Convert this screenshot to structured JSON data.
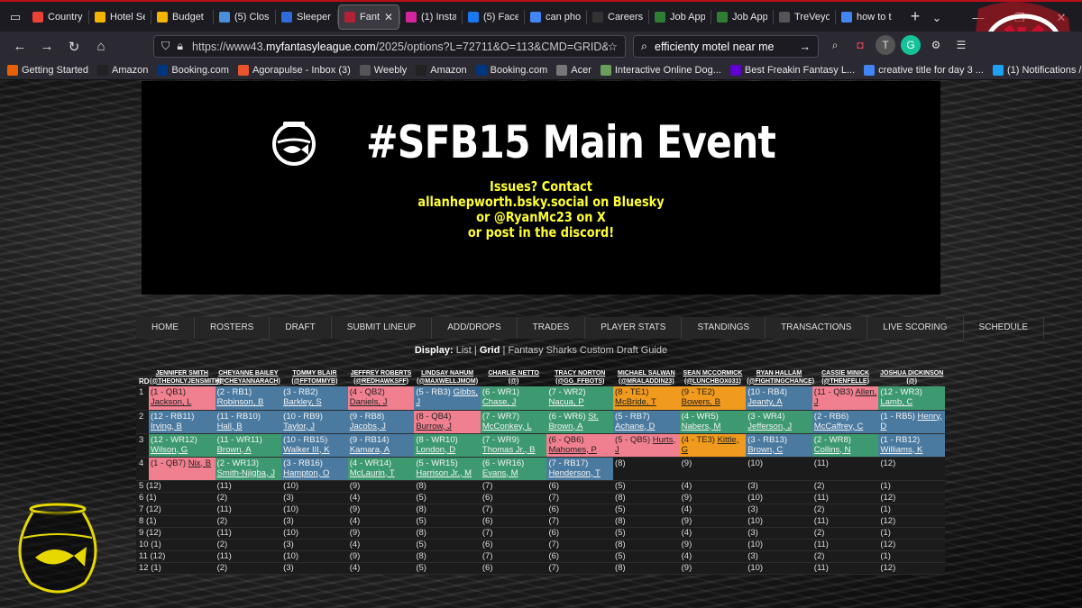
{
  "browser": {
    "tabs": [
      {
        "title": "Country",
        "icon": "gmail-icon",
        "color": "#ea4335"
      },
      {
        "title": "Hotel Se",
        "icon": "sheets-icon",
        "color": "#f4b400"
      },
      {
        "title": "Budget",
        "icon": "sheets-icon",
        "color": "#f4b400"
      },
      {
        "title": "(5) Close",
        "icon": "chat-icon",
        "color": "#4a90d9"
      },
      {
        "title": "Sleeper",
        "icon": "sleeper-icon",
        "color": "#2f6bd9"
      },
      {
        "title": "Fant",
        "icon": "mfl-icon",
        "color": "#b22234",
        "active": true
      },
      {
        "title": "(1) Insta",
        "icon": "instagram-icon",
        "color": "#d6249f"
      },
      {
        "title": "(5) Faceb",
        "icon": "facebook-icon",
        "color": "#1877f2"
      },
      {
        "title": "can phon",
        "icon": "google-icon",
        "color": "#4285f4"
      },
      {
        "title": "Careers",
        "icon": "careers-icon",
        "color": "#333333"
      },
      {
        "title": "Job App",
        "icon": "job-icon",
        "color": "#2e7d32"
      },
      {
        "title": "Job App",
        "icon": "job-icon",
        "color": "#2e7d32"
      },
      {
        "title": "TreVeyor",
        "icon": "fp-icon",
        "color": "#555555"
      },
      {
        "title": "how to t",
        "icon": "google-icon",
        "color": "#4285f4"
      }
    ],
    "close_glyph": "✕",
    "url_prefix": "https://www43.",
    "url_domain": "myfantasyleague.com",
    "url_rest": "/2025/options?L=72711&O=113&CMD=GRID&DISPLAY=",
    "search_text": "efficienty motel near me",
    "bookmarks": [
      {
        "label": "Getting Started",
        "icon": "firefox-icon",
        "color": "#e66000"
      },
      {
        "label": "Amazon",
        "icon": "amazon-icon",
        "color": "#222222"
      },
      {
        "label": "Booking.com",
        "icon": "booking-icon",
        "color": "#003580"
      },
      {
        "label": "Agorapulse - Inbox (3)",
        "icon": "agorapulse-icon",
        "color": "#e8542b"
      },
      {
        "label": "Weebly",
        "icon": "weebly-icon",
        "color": "#555555"
      },
      {
        "label": "Amazon",
        "icon": "amazon-icon",
        "color": "#222222"
      },
      {
        "label": "Booking.com",
        "icon": "booking-icon",
        "color": "#003580"
      },
      {
        "label": "Acer",
        "icon": "folder-icon",
        "color": "#777777"
      },
      {
        "label": "Interactive Online Dog...",
        "icon": "dog-icon",
        "color": "#6a9e5a"
      },
      {
        "label": "Best Freakin Fantasy L...",
        "icon": "yahoo-icon",
        "color": "#6001d2"
      },
      {
        "label": "creative title for day 3 ...",
        "icon": "google-icon",
        "color": "#4285f4"
      },
      {
        "label": "(1) Notifications / Twit...",
        "icon": "twitter-icon",
        "color": "#1da1f2"
      }
    ]
  },
  "banner": {
    "title": "#SFB15 Main Event",
    "contact_lines": [
      "Issues? Contact",
      "allanhepworth.bsky.social on Bluesky",
      "or @RyanMc23 on X",
      "or post in the discord!"
    ]
  },
  "menu": [
    "HOME",
    "ROSTERS",
    "DRAFT",
    "SUBMIT LINEUP",
    "ADD/DROPS",
    "TRADES",
    "PLAYER STATS",
    "STANDINGS",
    "TRANSACTIONS",
    "LIVE SCORING",
    "SCHEDULE"
  ],
  "display": {
    "label": "Display:",
    "list": "List",
    "sep": "|",
    "grid": "Grid",
    "guide": "Fantasy Sharks Custom Draft Guide"
  },
  "draft": {
    "rd_header": "RD",
    "teams": [
      {
        "name": "JENNIFER SMITH",
        "handle": "(@THEONLYJENSMITH)"
      },
      {
        "name": "CHEYANNE BAILEY",
        "handle": "(@CHEYANNARACH)"
      },
      {
        "name": "TOMMY BLAIR",
        "handle": "(@FFTOMMYB)"
      },
      {
        "name": "JEFFREY ROBERTS",
        "handle": "(@REDHAWKSFF)"
      },
      {
        "name": "LINDSAY NAHUM",
        "handle": "(@MAXWELLJMOM)"
      },
      {
        "name": "CHARLIE NETTO",
        "handle": "(@)"
      },
      {
        "name": "TRACY NORTON",
        "handle": "(@GG_FFBOTS)"
      },
      {
        "name": "MICHAEL SALWAN",
        "handle": "(@MRALADDIN23)"
      },
      {
        "name": "SEAN MCCORMICK",
        "handle": "(@LUNCHBOX031)"
      },
      {
        "name": "RYAN HALLAM",
        "handle": "(@FIGHTINGCHANCE)"
      },
      {
        "name": "CASSIE MINICK",
        "handle": "(@THENFELLE)"
      },
      {
        "name": "JOSHUA DICKINSON",
        "handle": "(@)"
      }
    ],
    "picks": [
      {
        "rd": "1",
        "cells": [
          {
            "pos": "QB",
            "tag": "(1 - QB1)",
            "player": "Jackson, L"
          },
          {
            "pos": "RB",
            "tag": "(2 - RB1)",
            "player": "Robinson, B"
          },
          {
            "pos": "RB",
            "tag": "(3 - RB2)",
            "player": "Barkley, S"
          },
          {
            "pos": "QB",
            "tag": "(4 - QB2)",
            "player": "Daniels, J"
          },
          {
            "pos": "RB",
            "tag": "(5 - RB3)",
            "player": "Gibbs, J"
          },
          {
            "pos": "WR",
            "tag": "(6 - WR1)",
            "player": "Chase, J"
          },
          {
            "pos": "WR",
            "tag": "(7 - WR2)",
            "player": "Nacua, P"
          },
          {
            "pos": "TE",
            "tag": "(8 - TE1)",
            "player": "McBride, T"
          },
          {
            "pos": "TE",
            "tag": "(9 - TE2)",
            "player": "Bowers, B"
          },
          {
            "pos": "RB",
            "tag": "(10 - RB4)",
            "player": "Jeanty, A"
          },
          {
            "pos": "QB",
            "tag": "(11 - QB3)",
            "player": "Allen, J"
          },
          {
            "pos": "WR",
            "tag": "(12 - WR3)",
            "player": "Lamb, C"
          }
        ]
      },
      {
        "rd": "2",
        "cells": [
          {
            "pos": "RB",
            "tag": "(12 - RB11)",
            "player": "Irving, B"
          },
          {
            "pos": "RB",
            "tag": "(11 - RB10)",
            "player": "Hall, B"
          },
          {
            "pos": "RB",
            "tag": "(10 - RB9)",
            "player": "Taylor, J"
          },
          {
            "pos": "RB",
            "tag": "(9 - RB8)",
            "player": "Jacobs, J"
          },
          {
            "pos": "QB",
            "tag": "(8 - QB4)",
            "player": "Burrow, J"
          },
          {
            "pos": "WR",
            "tag": "(7 - WR7)",
            "player": "McConkey, L"
          },
          {
            "pos": "WR",
            "tag": "(6 - WR6)",
            "player": "St. Brown, A"
          },
          {
            "pos": "RB",
            "tag": "(5 - RB7)",
            "player": "Achane, D"
          },
          {
            "pos": "WR",
            "tag": "(4 - WR5)",
            "player": "Nabers, M"
          },
          {
            "pos": "WR",
            "tag": "(3 - WR4)",
            "player": "Jefferson, J"
          },
          {
            "pos": "RB",
            "tag": "(2 - RB6)",
            "player": "McCaffrey, C"
          },
          {
            "pos": "RB",
            "tag": "(1 - RB5)",
            "player": "Henry, D"
          }
        ]
      },
      {
        "rd": "3",
        "cells": [
          {
            "pos": "WR",
            "tag": "(12 - WR12)",
            "player": "Wilson, G"
          },
          {
            "pos": "WR",
            "tag": "(11 - WR11)",
            "player": "Brown, A"
          },
          {
            "pos": "RB",
            "tag": "(10 - RB15)",
            "player": "Walker III, K"
          },
          {
            "pos": "RB",
            "tag": "(9 - RB14)",
            "player": "Kamara, A"
          },
          {
            "pos": "WR",
            "tag": "(8 - WR10)",
            "player": "London, D"
          },
          {
            "pos": "WR",
            "tag": "(7 - WR9)",
            "player": "Thomas Jr., B"
          },
          {
            "pos": "QB",
            "tag": "(6 - QB6)",
            "player": "Mahomes, P"
          },
          {
            "pos": "QB",
            "tag": "(5 - QB5)",
            "player": "Hurts, J"
          },
          {
            "pos": "TE",
            "tag": "(4 - TE3)",
            "player": "Kittle, G"
          },
          {
            "pos": "RB",
            "tag": "(3 - RB13)",
            "player": "Brown, C"
          },
          {
            "pos": "WR",
            "tag": "(2 - WR8)",
            "player": "Collins, N"
          },
          {
            "pos": "RB",
            "tag": "(1 - RB12)",
            "player": "Williams, K"
          }
        ]
      },
      {
        "rd": "4",
        "cells": [
          {
            "pos": "QB",
            "tag": "(1 - QB7)",
            "player": "Nix, B"
          },
          {
            "pos": "WR",
            "tag": "(2 - WR13)",
            "player": "Smith-Njigba, J"
          },
          {
            "pos": "RB",
            "tag": "(3 - RB16)",
            "player": "Hampton, O"
          },
          {
            "pos": "WR",
            "tag": "(4 - WR14)",
            "player": "McLaurin, T"
          },
          {
            "pos": "WR",
            "tag": "(5 - WR15)",
            "player": "Harrison Jr., M"
          },
          {
            "pos": "WR",
            "tag": "(6 - WR16)",
            "player": "Evans, M"
          },
          {
            "pos": "RB",
            "tag": "(7 - RB17)",
            "player": "Henderson, T"
          },
          {
            "pos": "",
            "tag": "(8)",
            "player": ""
          },
          {
            "pos": "",
            "tag": "(9)",
            "player": ""
          },
          {
            "pos": "",
            "tag": "(10)",
            "player": ""
          },
          {
            "pos": "",
            "tag": "(11)",
            "player": ""
          },
          {
            "pos": "",
            "tag": "(12)",
            "player": ""
          }
        ]
      }
    ],
    "future_rows": [
      {
        "rd": "5",
        "first": "(12)",
        "slots": [
          "(11)",
          "(10)",
          "(9)",
          "(8)",
          "(7)",
          "(6)",
          "(5)",
          "(4)",
          "(3)",
          "(2)",
          "(1)"
        ]
      },
      {
        "rd": "6",
        "first": "(1)",
        "slots": [
          "(2)",
          "(3)",
          "(4)",
          "(5)",
          "(6)",
          "(7)",
          "(8)",
          "(9)",
          "(10)",
          "(11)",
          "(12)"
        ]
      },
      {
        "rd": "7",
        "first": "(12)",
        "slots": [
          "(11)",
          "(10)",
          "(9)",
          "(8)",
          "(7)",
          "(6)",
          "(5)",
          "(4)",
          "(3)",
          "(2)",
          "(1)"
        ]
      },
      {
        "rd": "8",
        "first": "(1)",
        "slots": [
          "(2)",
          "(3)",
          "(4)",
          "(5)",
          "(6)",
          "(7)",
          "(8)",
          "(9)",
          "(10)",
          "(11)",
          "(12)"
        ]
      },
      {
        "rd": "9",
        "first": "(12)",
        "slots": [
          "(11)",
          "(10)",
          "(9)",
          "(8)",
          "(7)",
          "(6)",
          "(5)",
          "(4)",
          "(3)",
          "(2)",
          "(1)"
        ]
      },
      {
        "rd": "10",
        "first": "(1)",
        "slots": [
          "(2)",
          "(3)",
          "(4)",
          "(5)",
          "(6)",
          "(7)",
          "(8)",
          "(9)",
          "(10)",
          "(11)",
          "(12)"
        ]
      },
      {
        "rd": "11",
        "first": "(12)",
        "slots": [
          "(11)",
          "(10)",
          "(9)",
          "(8)",
          "(7)",
          "(6)",
          "(5)",
          "(4)",
          "(3)",
          "(2)",
          "(1)"
        ]
      },
      {
        "rd": "12",
        "first": "(1)",
        "slots": [
          "(2)",
          "(3)",
          "(4)",
          "(5)",
          "(6)",
          "(7)",
          "(8)",
          "(9)",
          "(10)",
          "(11)",
          "(12)"
        ]
      }
    ]
  },
  "colors": {
    "QB": "#f08090",
    "RB": "#4a7aa0",
    "WR": "#3d9a70",
    "TE": "#f09a1e",
    "banner_text": "#ffff33"
  }
}
